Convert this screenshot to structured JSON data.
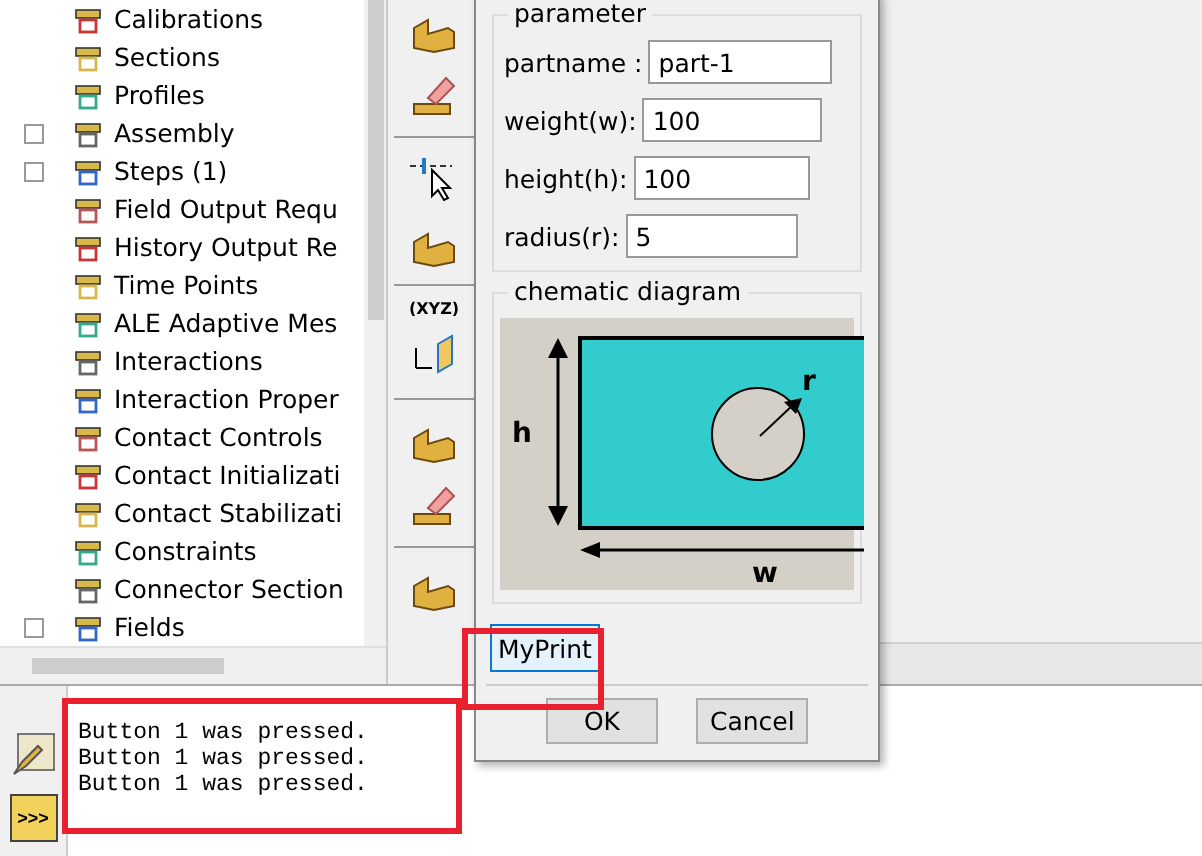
{
  "tree": {
    "items": [
      {
        "label": "Calibrations",
        "expandable": false
      },
      {
        "label": "Sections",
        "expandable": false
      },
      {
        "label": "Profiles",
        "expandable": false
      },
      {
        "label": "Assembly",
        "expandable": true
      },
      {
        "label": "Steps (1)",
        "expandable": true
      },
      {
        "label": "Field Output Requ",
        "expandable": false
      },
      {
        "label": "History Output Re",
        "expandable": false
      },
      {
        "label": "Time Points",
        "expandable": false
      },
      {
        "label": "ALE Adaptive Mes",
        "expandable": false
      },
      {
        "label": "Interactions",
        "expandable": false
      },
      {
        "label": "Interaction Proper",
        "expandable": false
      },
      {
        "label": "Contact Controls",
        "expandable": false
      },
      {
        "label": "Contact Initializati",
        "expandable": false
      },
      {
        "label": "Contact Stabilizati",
        "expandable": false
      },
      {
        "label": "Constraints",
        "expandable": false
      },
      {
        "label": "Connector Section",
        "expandable": false
      },
      {
        "label": "Fields",
        "expandable": true
      }
    ]
  },
  "toolbar": {
    "xyz_label": "(XYZ)"
  },
  "dialog": {
    "parameter_group": {
      "title": "parameter",
      "fields": [
        {
          "label": "partname :",
          "value": "part-1"
        },
        {
          "label": "weight(w):",
          "value": "100"
        },
        {
          "label": "height(h):",
          "value": "100"
        },
        {
          "label": "radius(r):",
          "value": "5"
        }
      ]
    },
    "diagram_group": {
      "title": "chematic diagram",
      "h_label": "h",
      "w_label": "w",
      "r_label": "r"
    },
    "custom_button": "MyPrint",
    "ok": "OK",
    "cancel": "Cancel"
  },
  "console": {
    "prompt_button": ">>>",
    "lines": [
      "Button 1 was pressed.",
      "Button 1 was pressed.",
      "Button 1 was pressed."
    ]
  }
}
